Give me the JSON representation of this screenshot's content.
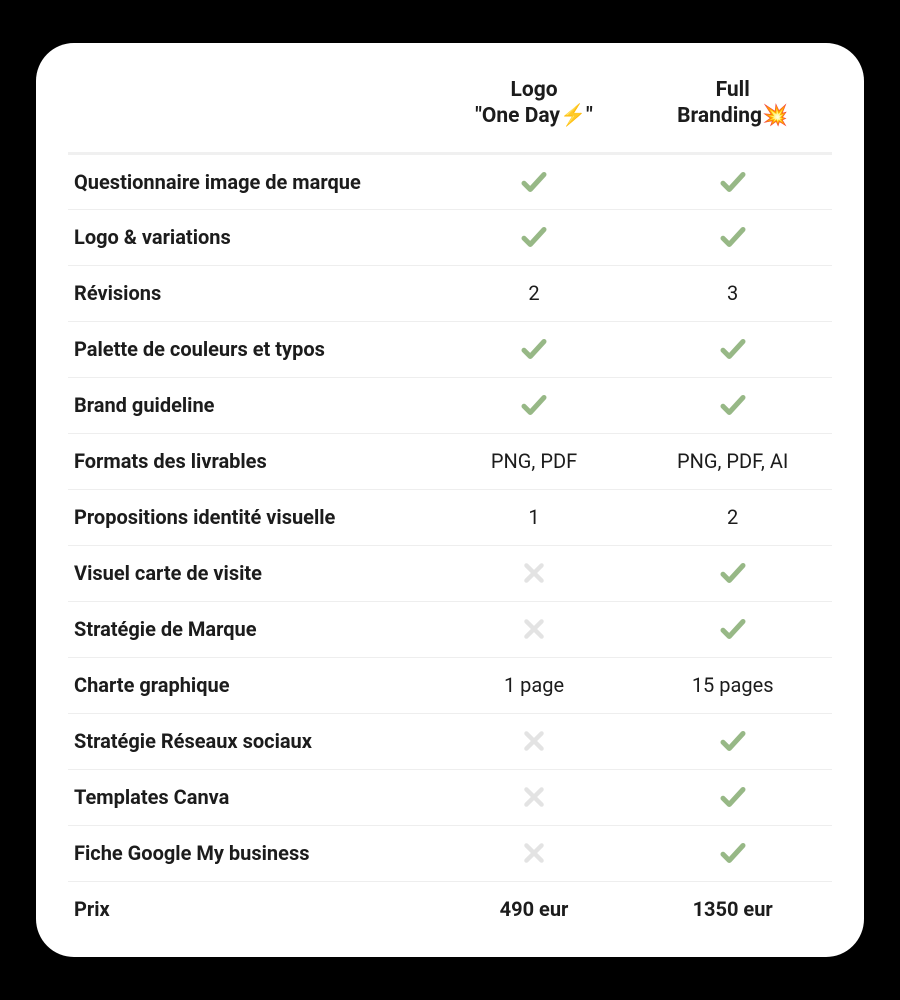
{
  "plans": [
    {
      "name_line1": "Logo",
      "name_line2": "\"One Day⚡\""
    },
    {
      "name_line1": "Full",
      "name_line2": "Branding💥"
    }
  ],
  "rows": [
    {
      "feature": "Questionnaire image de marque",
      "values": [
        "check",
        "check"
      ]
    },
    {
      "feature": "Logo & variations",
      "values": [
        "check",
        "check"
      ]
    },
    {
      "feature": "Révisions",
      "values": [
        "2",
        "3"
      ]
    },
    {
      "feature": "Palette de couleurs et typos",
      "values": [
        "check",
        "check"
      ]
    },
    {
      "feature": "Brand guideline",
      "values": [
        "check",
        "check"
      ]
    },
    {
      "feature": "Formats des livrables",
      "values": [
        "PNG, PDF",
        "PNG, PDF, AI"
      ]
    },
    {
      "feature": "Propositions identité visuelle",
      "values": [
        "1",
        "2"
      ]
    },
    {
      "feature": "Visuel carte de visite",
      "values": [
        "cross",
        "check"
      ]
    },
    {
      "feature": "Stratégie de Marque",
      "values": [
        "cross",
        "check"
      ]
    },
    {
      "feature": "Charte graphique",
      "values": [
        "1 page",
        "15 pages"
      ]
    },
    {
      "feature": "Stratégie Réseaux sociaux",
      "values": [
        "cross",
        "check"
      ]
    },
    {
      "feature": "Templates Canva",
      "values": [
        "cross",
        "check"
      ]
    },
    {
      "feature": "Fiche Google My business",
      "values": [
        "cross",
        "check"
      ]
    }
  ],
  "price_label": "Prix",
  "prices": [
    "490 eur",
    "1350 eur"
  ],
  "colors": {
    "check": "#97b886",
    "cross": "#e3e3e3"
  }
}
